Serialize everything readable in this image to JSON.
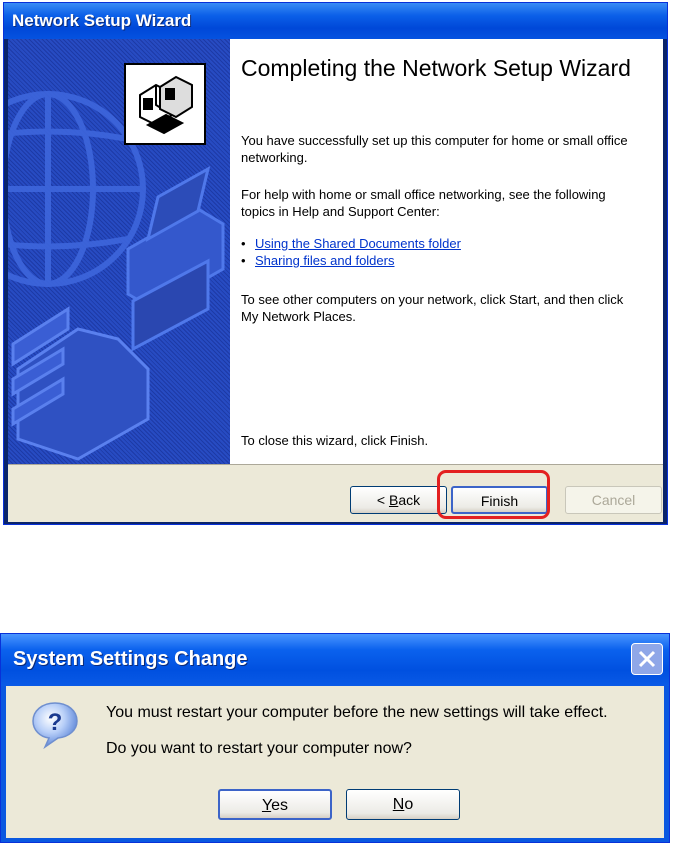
{
  "wizard": {
    "title": "Network Setup Wizard",
    "heading": "Completing the Network Setup Wizard",
    "para1": "You have successfully set up this computer for home or small office networking.",
    "para2": "For help with home or small office networking, see the following topics in Help and Support Center:",
    "links": [
      "Using the Shared Documents folder",
      "Sharing files and folders"
    ],
    "para3": "To see other computers on your network, click Start, and then click My Network Places.",
    "para4": "To close this wizard, click Finish.",
    "buttons": {
      "back_prefix": "< ",
      "back_hotkey": "B",
      "back_rest": "ack",
      "finish": "Finish",
      "cancel": "Cancel"
    },
    "highlight_color": "#e32020"
  },
  "dialog": {
    "title": "System Settings Change",
    "message": "You must restart your computer before the new settings will take effect.",
    "question": "Do you want to restart your computer now?",
    "icon": "question-icon",
    "buttons": {
      "yes_hotkey": "Y",
      "yes_rest": "es",
      "no_hotkey": "N",
      "no_rest": "o"
    }
  },
  "colors": {
    "titlebar_blue": "#0050e0",
    "link_blue": "#0033cc",
    "dialog_face": "#ece9d8"
  }
}
